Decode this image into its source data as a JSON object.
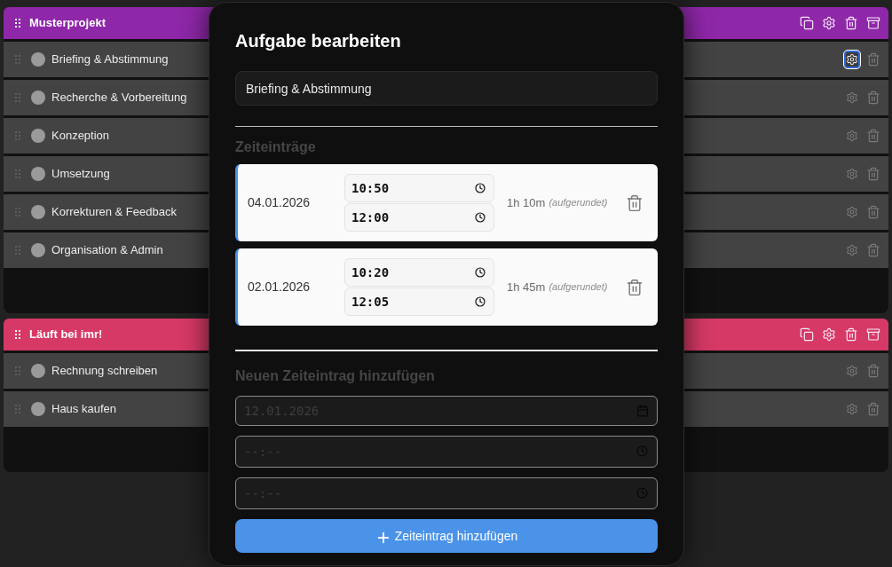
{
  "projects": [
    {
      "title": "Musterprojekt",
      "color": "#8e27a8",
      "tasks": [
        {
          "name": "Briefing & Abstimmung",
          "settings_focused": true
        },
        {
          "name": "Recherche & Vorbereitung",
          "settings_focused": false
        },
        {
          "name": "Konzeption",
          "settings_focused": false
        },
        {
          "name": "Umsetzung",
          "settings_focused": false
        },
        {
          "name": "Korrekturen & Feedback",
          "settings_focused": false
        },
        {
          "name": "Organisation & Admin",
          "settings_focused": false
        }
      ]
    },
    {
      "title": "Läuft bei imr!",
      "color": "#d63966",
      "tasks": [
        {
          "name": "Rechnung schreiben",
          "settings_focused": false
        },
        {
          "name": "Haus kaufen",
          "settings_focused": false
        }
      ]
    }
  ],
  "dialog": {
    "title": "Aufgabe bearbeiten",
    "name_field": {
      "value": "Briefing & Abstimmung"
    },
    "entries_heading": "Zeiteinträge",
    "entries": [
      {
        "date": "04.01.2026",
        "start": "10:50",
        "end": "12:00",
        "duration": "1h 10m",
        "note": "(aufgerundet)"
      },
      {
        "date": "02.01.2026",
        "start": "10:20",
        "end": "12:05",
        "duration": "1h 45m",
        "note": "(aufgerundet)"
      }
    ],
    "new_entry_heading": "Neuen Zeiteintrag hinzufügen",
    "new_entry_fields": [
      {
        "kind": "date",
        "placeholder": "12.01.2026"
      },
      {
        "kind": "time",
        "placeholder": "--:--"
      },
      {
        "kind": "time",
        "placeholder": "--:--"
      }
    ],
    "add_button": {
      "label": "Zeiteintrag hinzufügen"
    }
  }
}
